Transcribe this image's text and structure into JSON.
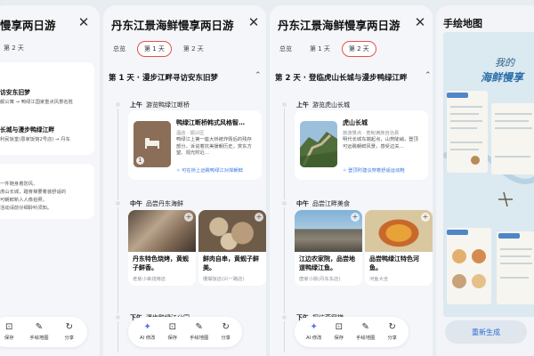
{
  "panel1": {
    "title": "慢享两日游",
    "tab": "第 2 天",
    "card1": {
      "line1": "访安东旧梦",
      "line2": "舰公寓 → 鸭绿江国家重点风景名胜",
      "line3": "长城与漫步鸭绿江畔",
      "line4": "利民饭堂(恩家饭馆2号店) → 丹东"
    },
    "card2": {
      "lines": [
        "一件随身着防风、",
        "虎山长城，踏脊梯要着装舒适的",
        "可朝鲜新人人像拍照，",
        "活动请前仔细聆听须知。"
      ]
    },
    "toolbar": [
      {
        "icon": "save-icon",
        "glyph": "⊡",
        "label": "保存"
      },
      {
        "icon": "map-icon",
        "glyph": "✎",
        "label": "手绘地图"
      },
      {
        "icon": "share-icon",
        "glyph": "↻",
        "label": "分享"
      }
    ]
  },
  "panel2": {
    "title": "丹东江景海鲜慢享两日游",
    "tabs": [
      "总览",
      "第 1 天",
      "第 2 天"
    ],
    "day_title": "第 1 天 · 漫步江畔寻访安东旧梦",
    "morning": {
      "period": "上午",
      "name": "游览鸭绿江断桥"
    },
    "spot": {
      "title": "鸭绿江断桥韩式风格智…",
      "sub": "酒店 · 振兴区",
      "desc": "鸭绿江上第一座大桥被炸毁后的残存部分，诉说着抗美援朝历史，赏东方望、观光附近…",
      "link": "可在桥上远眺鸭绿江对岸朝鲜",
      "thumb_num": "1"
    },
    "noon": {
      "period": "中午",
      "name": "品尝丹东海鲜"
    },
    "foods": [
      {
        "name": "丹东特色烧烤，黄蚬子鲜香。",
        "sub": "老房小串烧烤店"
      },
      {
        "name": "鲜肉自串，黄蚬子鲜美。",
        "sub": "珊瑚饭店(兴一路店)"
      }
    ],
    "afternoon": {
      "period": "下午",
      "name": "漫步鸭绿江公园"
    },
    "toolbar": [
      {
        "icon": "ai-edit-icon",
        "glyph": "✦",
        "label": "AI 修改"
      },
      {
        "icon": "save-icon",
        "glyph": "⊡",
        "label": "保存"
      },
      {
        "icon": "map-icon",
        "glyph": "✎",
        "label": "手绘地图"
      },
      {
        "icon": "share-icon",
        "glyph": "↻",
        "label": "分享"
      }
    ]
  },
  "panel3": {
    "title": "丹东江景海鲜慢享两日游",
    "tabs": [
      "总览",
      "第 1 天",
      "第 2 天"
    ],
    "day_title": "第 2 天 · 登临虎山长城与漫步鸭绿江畔",
    "morning": {
      "period": "上午",
      "name": "游览虎山长城"
    },
    "spot": {
      "title": "虎山长城",
      "sub": "旅游景点 · 宽甸满族自治县",
      "desc": "明代长城东端起点，山势陡峭，登顶可远眺朝鲜风景，感受边关…",
      "link": "登顶时建议穿着舒适运动鞋"
    },
    "noon": {
      "period": "中午",
      "name": "品尝江畔美食"
    },
    "foods": [
      {
        "name": "江边农家院，品尝地道鸭绿江鱼。",
        "sub": "唐家小院(丹东东店)"
      },
      {
        "name": "品尝鸭绿江特色河鱼。",
        "sub": "河鱼大全"
      }
    ],
    "afternoon": {
      "period": "下午",
      "name": "探访燕窝梯"
    },
    "toolbar": [
      {
        "icon": "ai-edit-icon",
        "glyph": "✦",
        "label": "AI 修改"
      },
      {
        "icon": "save-icon",
        "glyph": "⊡",
        "label": "保存"
      },
      {
        "icon": "map-icon",
        "glyph": "✎",
        "label": "手绘地图"
      },
      {
        "icon": "share-icon",
        "glyph": "↻",
        "label": "分享"
      }
    ]
  },
  "panel4": {
    "title": "手绘地图",
    "map_title1": "我的",
    "map_title2": "海鲜慢享",
    "regen": "重新生成"
  }
}
